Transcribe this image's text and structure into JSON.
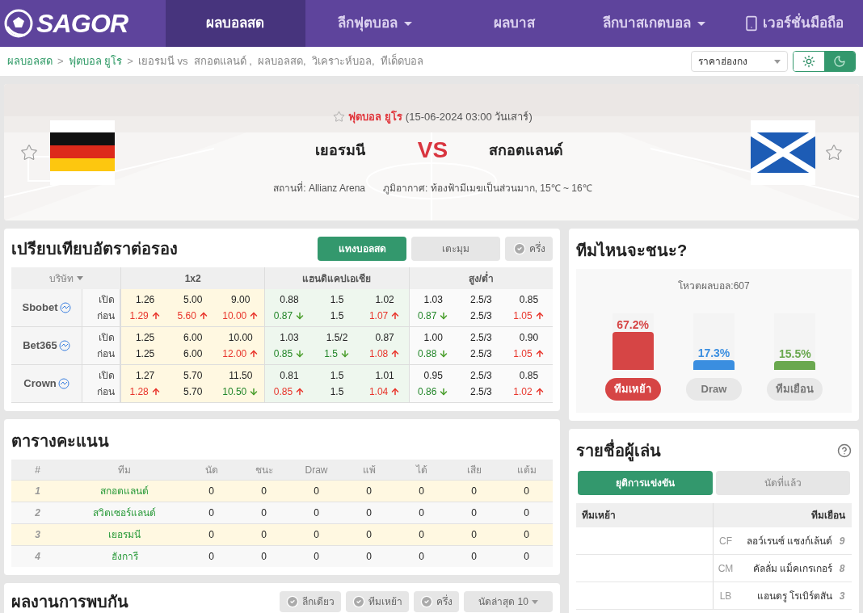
{
  "logo": {
    "text": "SAGOR"
  },
  "nav": {
    "items": [
      {
        "label": "ผลบอลสด",
        "selected": true,
        "kind": "link"
      },
      {
        "label": "ลีกฟุตบอล",
        "selected": false,
        "kind": "dropdown"
      },
      {
        "label": "ผลบาส",
        "selected": false,
        "kind": "link"
      },
      {
        "label": "ลีกบาสเกตบอล",
        "selected": false,
        "kind": "dropdown"
      },
      {
        "label": "เวอร์ชั่นมือถือ",
        "selected": false,
        "kind": "mobile"
      }
    ]
  },
  "breadcrumb": {
    "links": [
      "ผลบอลสด",
      "ฟุตบอล ยูโร"
    ],
    "separator": ">",
    "current": "เยอรมนี vs  สกอตแลนด์ ,  ผลบอลสด,  วิเคราะห์บอล,  ทีเด็ดบอล"
  },
  "odds_format": {
    "value": "ราคาฮ่องกง"
  },
  "match": {
    "league": "ฟุตบอล ยูโร",
    "datetime": "(15-06-2024 03:00 วันเสาร์)",
    "home": "เยอรมนี",
    "vs": "VS",
    "away": "สกอตแลนด์",
    "venue": "สถานที่: Allianz Arena",
    "weather": "ภูมิอากาศ: ท้องฟ้ามีเมฆเป็นส่วนมาก, 15℃ ~ 16℃"
  },
  "odds": {
    "title": "เปรียบเทียบอัตราต่อรอง",
    "buttons": [
      {
        "label": "แทงบอลสด",
        "kind": "primary"
      },
      {
        "label": "เตะมุม",
        "kind": "plain"
      },
      {
        "label": "ครึ่ง",
        "kind": "check"
      }
    ],
    "company_header": "บริษัท",
    "groups": [
      "1x2",
      "แฮนดิแคปเอเชีย",
      "สูง/ต่ำ"
    ],
    "rows": [
      {
        "company": "Sbobet",
        "lines": [
          {
            "label": "เปิด",
            "cells": [
              {
                "v": "1.26",
                "kind": "none"
              },
              {
                "v": "5.00",
                "kind": "none"
              },
              {
                "v": "9.00",
                "kind": "none"
              },
              {
                "v": "0.88",
                "kind": "none"
              },
              {
                "v": "1.5",
                "kind": "none"
              },
              {
                "v": "1.02",
                "kind": "none"
              },
              {
                "v": "1.03",
                "kind": "none"
              },
              {
                "v": "2.5/3",
                "kind": "none"
              },
              {
                "v": "0.85",
                "kind": "none"
              }
            ]
          },
          {
            "label": "ก่อน",
            "cells": [
              {
                "v": "1.29",
                "kind": "up"
              },
              {
                "v": "5.60",
                "kind": "up"
              },
              {
                "v": "10.00",
                "kind": "up"
              },
              {
                "v": "0.87",
                "kind": "down"
              },
              {
                "v": "1.5",
                "kind": "none"
              },
              {
                "v": "1.07",
                "kind": "up"
              },
              {
                "v": "0.87",
                "kind": "down"
              },
              {
                "v": "2.5/3",
                "kind": "none"
              },
              {
                "v": "1.05",
                "kind": "up"
              }
            ]
          }
        ]
      },
      {
        "company": "Bet365",
        "lines": [
          {
            "label": "เปิด",
            "cells": [
              {
                "v": "1.25",
                "kind": "none"
              },
              {
                "v": "6.00",
                "kind": "none"
              },
              {
                "v": "10.00",
                "kind": "none"
              },
              {
                "v": "1.03",
                "kind": "none"
              },
              {
                "v": "1.5/2",
                "kind": "none"
              },
              {
                "v": "0.87",
                "kind": "none"
              },
              {
                "v": "1.00",
                "kind": "none"
              },
              {
                "v": "2.5/3",
                "kind": "none"
              },
              {
                "v": "0.90",
                "kind": "none"
              }
            ]
          },
          {
            "label": "ก่อน",
            "cells": [
              {
                "v": "1.25",
                "kind": "none"
              },
              {
                "v": "6.00",
                "kind": "none"
              },
              {
                "v": "12.00",
                "kind": "up"
              },
              {
                "v": "0.85",
                "kind": "down"
              },
              {
                "v": "1.5",
                "kind": "down"
              },
              {
                "v": "1.08",
                "kind": "up"
              },
              {
                "v": "0.88",
                "kind": "down"
              },
              {
                "v": "2.5/3",
                "kind": "none"
              },
              {
                "v": "1.05",
                "kind": "up"
              }
            ]
          }
        ]
      },
      {
        "company": "Crown",
        "lines": [
          {
            "label": "เปิด",
            "cells": [
              {
                "v": "1.27",
                "kind": "none"
              },
              {
                "v": "5.70",
                "kind": "none"
              },
              {
                "v": "11.50",
                "kind": "none"
              },
              {
                "v": "0.81",
                "kind": "none"
              },
              {
                "v": "1.5",
                "kind": "none"
              },
              {
                "v": "1.01",
                "kind": "none"
              },
              {
                "v": "0.95",
                "kind": "none"
              },
              {
                "v": "2.5/3",
                "kind": "none"
              },
              {
                "v": "0.85",
                "kind": "none"
              }
            ]
          },
          {
            "label": "ก่อน",
            "cells": [
              {
                "v": "1.28",
                "kind": "up"
              },
              {
                "v": "5.70",
                "kind": "none"
              },
              {
                "v": "10.50",
                "kind": "down"
              },
              {
                "v": "0.85",
                "kind": "up"
              },
              {
                "v": "1.5",
                "kind": "none"
              },
              {
                "v": "1.04",
                "kind": "up"
              },
              {
                "v": "0.86",
                "kind": "down"
              },
              {
                "v": "2.5/3",
                "kind": "none"
              },
              {
                "v": "1.02",
                "kind": "up"
              }
            ]
          }
        ]
      }
    ]
  },
  "standings": {
    "title": "ตารางคะแนน",
    "columns": [
      "#",
      "ทีม",
      "นัด",
      "ชนะ",
      "Draw",
      "แพ้",
      "ได้",
      "เสีย",
      "แต้ม"
    ],
    "rows": [
      {
        "highlighted": true,
        "cells": [
          "1",
          "สกอตแลนด์",
          "0",
          "0",
          "0",
          "0",
          "0",
          "0",
          "0"
        ]
      },
      {
        "highlighted": false,
        "cells": [
          "2",
          "สวิตเซอร์แลนด์",
          "0",
          "0",
          "0",
          "0",
          "0",
          "0",
          "0"
        ]
      },
      {
        "highlighted": true,
        "cells": [
          "3",
          "เยอรมนี",
          "0",
          "0",
          "0",
          "0",
          "0",
          "0",
          "0"
        ]
      },
      {
        "highlighted": false,
        "cells": [
          "4",
          "ฮังการี",
          "0",
          "0",
          "0",
          "0",
          "0",
          "0",
          "0"
        ]
      }
    ]
  },
  "head_to_head": {
    "title": "ผลงานการพบกัน",
    "filters": [
      {
        "label": "ลีกเดียว",
        "checked": false
      },
      {
        "label": "ทีมเหย้า",
        "checked": false
      },
      {
        "label": "ครึ่ง",
        "checked": false
      }
    ],
    "count_select": "นัดล่าสุด 10"
  },
  "vote": {
    "title": "ทีมไหนจะชนะ?",
    "total": "โหวตผลบอล:607",
    "options": [
      {
        "percent": "67.2%",
        "level": 0.672,
        "color": "#d64545",
        "label": "ทีมเหย้า",
        "selected": true
      },
      {
        "percent": "17.3%",
        "level": 0.173,
        "color": "#3a8ee0",
        "label": "Draw",
        "selected": false
      },
      {
        "percent": "15.5%",
        "level": 0.155,
        "color": "#6aa84f",
        "label": "ทีมเยือน",
        "selected": false
      }
    ]
  },
  "players": {
    "title": "รายชื่อผู้เล่น",
    "tabs": [
      {
        "label": "ยุติการแข่งขัน",
        "selected": true
      },
      {
        "label": "นัดที่แล้ว",
        "selected": false
      }
    ],
    "home_header": "ทีมเหย้า",
    "away_header": "ทีมเยือน",
    "away": [
      {
        "pos": "CF",
        "name": "ลอว์เรนซ์ แชงก์เล้นด์",
        "number": "9"
      },
      {
        "pos": "CM",
        "name": "คัลลั่ม แม็คเกรเกอร์",
        "number": "8"
      },
      {
        "pos": "LB",
        "name": "แอนดรู โรเบิร์ตสัน",
        "number": "3"
      }
    ]
  }
}
